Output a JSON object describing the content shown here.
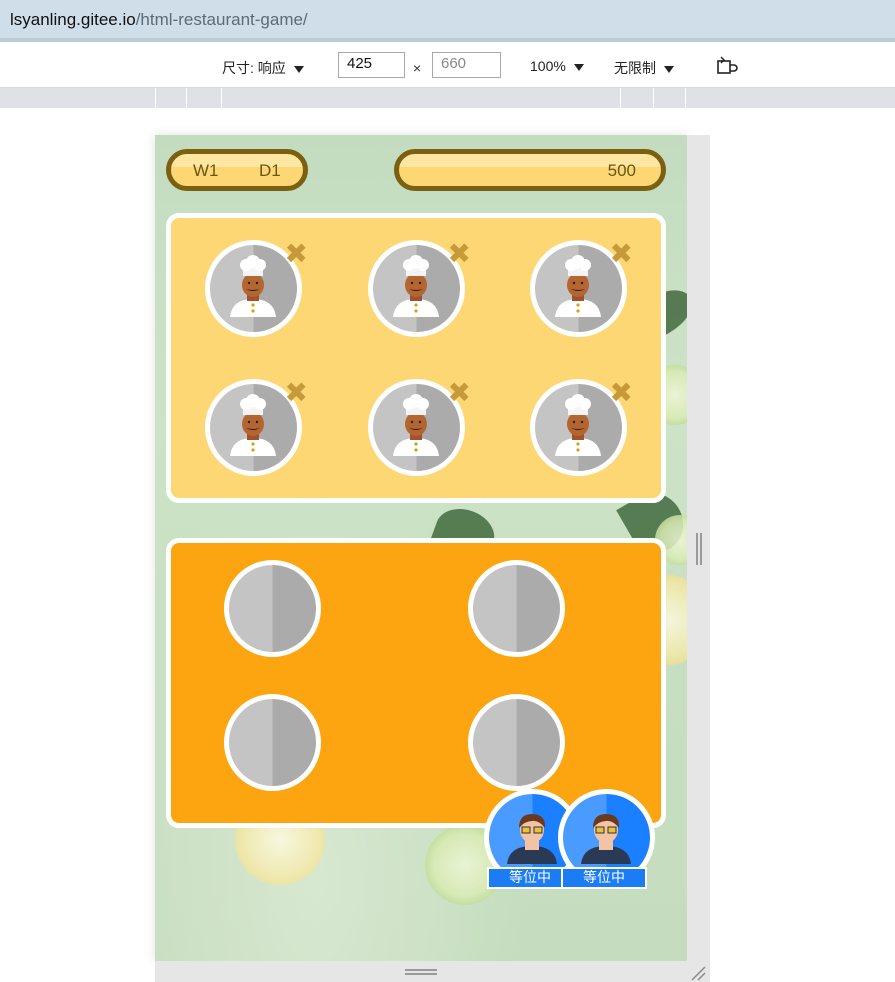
{
  "browser": {
    "url_host": "lsyanling.gitee.io",
    "url_path": "/html-restaurant-game/"
  },
  "device_toolbar": {
    "dimensions_label": "尺寸: 响应",
    "width_value": "425",
    "times": "×",
    "height_placeholder": "660",
    "zoom": "100%",
    "throttle": "无限制"
  },
  "game": {
    "week_label": "W1",
    "day_label": "D1",
    "money": "500",
    "kitchen": {
      "chef_count": 6,
      "chef_remove_glyph": "✖"
    },
    "dining": {
      "table_count": 4
    },
    "queue": [
      {
        "status": "等位中"
      },
      {
        "status": "等位中"
      }
    ]
  },
  "colors": {
    "kitchen_bg": "#fed775",
    "dining_bg": "#fda411",
    "pill_border": "#7a6010",
    "customer_blue": "#1b80ff",
    "remove_icon": "#c69a3a"
  }
}
